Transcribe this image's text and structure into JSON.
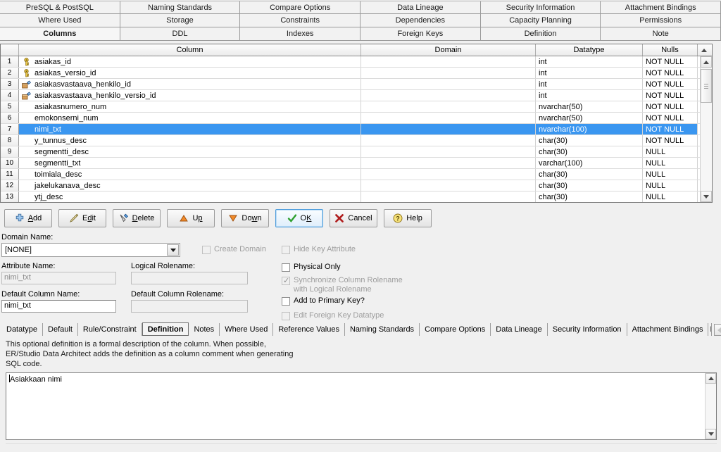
{
  "top_tabs": [
    {
      "row": 1,
      "items": [
        "PreSQL & PostSQL",
        "Naming Standards",
        "Compare Options",
        "Data Lineage",
        "Security Information",
        "Attachment Bindings"
      ]
    },
    {
      "row": 2,
      "items": [
        "Where Used",
        "Storage",
        "Constraints",
        "Dependencies",
        "Capacity Planning",
        "Permissions"
      ]
    },
    {
      "row": 3,
      "items": [
        "Columns",
        "DDL",
        "Indexes",
        "Foreign Keys",
        "Definition",
        "Note"
      ]
    }
  ],
  "active_top_tab": "Columns",
  "grid": {
    "headers": [
      "",
      "Column",
      "Domain",
      "Datatype",
      "Nulls"
    ],
    "selected_row_index": 6,
    "rows": [
      {
        "num": "1",
        "column": "asiakas_id",
        "icon": "primary-key-icon",
        "domain": "",
        "datatype": "int",
        "nulls": "NOT NULL"
      },
      {
        "num": "2",
        "column": "asiakas_versio_id",
        "icon": "primary-key-icon",
        "domain": "",
        "datatype": "int",
        "nulls": "NOT NULL"
      },
      {
        "num": "3",
        "column": "asiakasvastaava_henkilo_id",
        "icon": "foreign-key-icon",
        "domain": "",
        "datatype": "int",
        "nulls": "NOT NULL"
      },
      {
        "num": "4",
        "column": "asiakasvastaava_henkilo_versio_id",
        "icon": "foreign-key-icon",
        "domain": "",
        "datatype": "int",
        "nulls": "NOT NULL"
      },
      {
        "num": "5",
        "column": "asiakasnumero_num",
        "icon": "",
        "domain": "",
        "datatype": "nvarchar(50)",
        "nulls": "NOT NULL"
      },
      {
        "num": "6",
        "column": "emokonserni_num",
        "icon": "",
        "domain": "",
        "datatype": "nvarchar(50)",
        "nulls": "NOT NULL"
      },
      {
        "num": "7",
        "column": "nimi_txt",
        "icon": "",
        "domain": "",
        "datatype": "nvarchar(100)",
        "nulls": "NOT NULL"
      },
      {
        "num": "8",
        "column": "y_tunnus_desc",
        "icon": "",
        "domain": "",
        "datatype": "char(30)",
        "nulls": "NOT NULL"
      },
      {
        "num": "9",
        "column": "segmentti_desc",
        "icon": "",
        "domain": "",
        "datatype": "char(30)",
        "nulls": "NULL"
      },
      {
        "num": "10",
        "column": "segmentti_txt",
        "icon": "",
        "domain": "",
        "datatype": "varchar(100)",
        "nulls": "NULL"
      },
      {
        "num": "11",
        "column": "toimiala_desc",
        "icon": "",
        "domain": "",
        "datatype": "char(30)",
        "nulls": "NULL"
      },
      {
        "num": "12",
        "column": "jakelukanava_desc",
        "icon": "",
        "domain": "",
        "datatype": "char(30)",
        "nulls": "NULL"
      },
      {
        "num": "13",
        "column": "ytj_desc",
        "icon": "",
        "domain": "",
        "datatype": "char(30)",
        "nulls": "NULL"
      }
    ]
  },
  "buttons": [
    {
      "name": "add",
      "label_pre": "",
      "accel": "A",
      "label_post": "dd",
      "icon": "plus-icon"
    },
    {
      "name": "edit",
      "label_pre": "E",
      "accel": "d",
      "label_post": "it",
      "icon": "pencil-icon"
    },
    {
      "name": "delete",
      "label_pre": "",
      "accel": "D",
      "label_post": "elete",
      "icon": "delete-icon"
    },
    {
      "name": "up",
      "label_pre": "U",
      "accel": "p",
      "label_post": "",
      "icon": "up-triangle-icon"
    },
    {
      "name": "down",
      "label_pre": "Do",
      "accel": "w",
      "label_post": "n",
      "icon": "down-triangle-icon"
    },
    {
      "name": "ok",
      "label_pre": "O",
      "accel": "K",
      "label_post": "",
      "icon": "check-icon"
    },
    {
      "name": "cancel",
      "label_pre": "Cancel",
      "accel": "",
      "label_post": "",
      "icon": "x-icon"
    },
    {
      "name": "help",
      "label_pre": "Help",
      "accel": "",
      "label_post": "",
      "icon": "question-icon"
    }
  ],
  "form": {
    "domain_name_label": "Domain Name:",
    "domain_name_value": "[NONE]",
    "attribute_name_label": "Attribute Name:",
    "attribute_name_value": "nimi_txt",
    "logical_rolename_label": "Logical Rolename:",
    "logical_rolename_value": "",
    "default_column_name_label": "Default Column Name:",
    "default_column_name_value": "nimi_txt",
    "default_column_rolename_label": "Default Column Rolename:",
    "default_column_rolename_value": "",
    "checkboxes": [
      {
        "name": "create-domain",
        "label": "Create Domain",
        "checked": false,
        "disabled": true
      },
      {
        "name": "hide-key-attribute",
        "label": "Hide Key Attribute",
        "checked": false,
        "disabled": true
      },
      {
        "name": "physical-only",
        "label": "Physical Only",
        "checked": false,
        "disabled": false
      },
      {
        "name": "synchronize-rolename",
        "label": "Synchronize Column Rolename",
        "label2": "with Logical Rolename",
        "checked": true,
        "disabled": true
      },
      {
        "name": "add-to-primary-key",
        "label": "Add to Primary Key?",
        "checked": false,
        "disabled": false
      },
      {
        "name": "edit-fk-datatype",
        "label": "Edit Foreign Key Datatype",
        "checked": false,
        "disabled": true
      }
    ]
  },
  "bottom_tabs": {
    "items": [
      "Datatype",
      "Default",
      "Rule/Constraint",
      "Definition",
      "Notes",
      "Where Used",
      "Reference Values",
      "Naming Standards",
      "Compare Options",
      "Data Lineage",
      "Security Information",
      "Attachment Bindings"
    ],
    "active": "Definition",
    "clipped_item": "D",
    "scroll_left_label": "◀",
    "scroll_right_label": "▶"
  },
  "definition_panel": {
    "help_text": "This optional definition is a formal description of the column.  When possible,\nER/Studio Data Architect adds the definition as a column comment when generating\nSQL code.",
    "textarea_value": "Asiakkaan nimi"
  },
  "colors": {
    "selection_blue": "#3a96f0",
    "window_bg": "#f0f0f0",
    "grid_bg": "#ffffff",
    "disabled_text": "#9a9a9a"
  }
}
